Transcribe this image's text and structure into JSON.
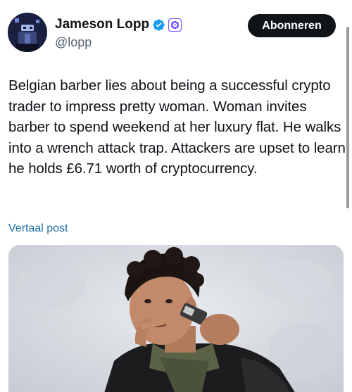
{
  "author": {
    "name": "Jameson Lopp",
    "handle": "@lopp"
  },
  "subscribe_label": "Abonneren",
  "tweet": {
    "text": "Belgian barber lies about being a successful crypto trader to impress pretty woman. Woman invites barber to spend weekend at her luxury flat. He walks into a wrench attack trap. Attackers are upset to learn he holds £6.71 worth of cryptocurrency."
  },
  "translate_label": "Vertaal post",
  "colors": {
    "verified_badge": "#1d9bf0",
    "affiliate_badge": "#7856ff",
    "link": "#1d6fa5",
    "button_bg": "#0f1419"
  },
  "icons": [
    "verified-badge-icon",
    "affiliate-badge-icon"
  ]
}
